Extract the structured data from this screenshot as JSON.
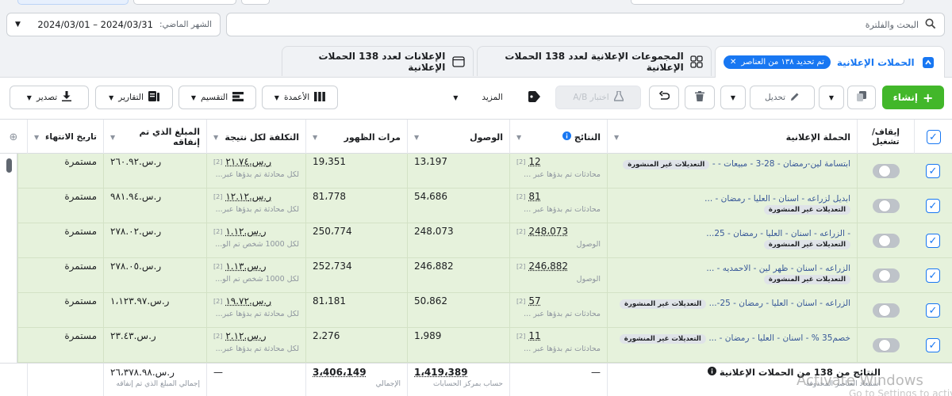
{
  "date_range": {
    "label": "الشهر الماضي:",
    "range": "2024/03/01 – 2024/03/31"
  },
  "search": {
    "placeholder": "البحث والفلترة"
  },
  "tabs": [
    {
      "label": "الحملات الإعلانية",
      "chip": "تم تحديد ١٣٨ من العناصر"
    },
    {
      "label": "المجموعات الإعلانية لعدد 138 الحملات الإعلانية"
    },
    {
      "label": "الإعلانات لعدد 138 الحملات الإعلانية"
    }
  ],
  "toolbar": {
    "create": "إنشاء",
    "edit": "تحديل",
    "ab_test": "اختبار A/B",
    "more": "المزيد",
    "columns": "الأعمدة",
    "breakdown": "التقسيم",
    "reports": "التقارير",
    "export": "تصدير"
  },
  "columns": {
    "toggle": "إيقاف/ تشغيل",
    "campaign": "الحملة الإعلانية",
    "results": "النتائج",
    "reach": "الوصول",
    "impressions": "مرات الظهور",
    "cost_per_result": "التكلفة لكل نتيجة",
    "amount_spent": "المبلغ الذي تم إنفاقه",
    "end_date": "تاريخ الانتهاء"
  },
  "badge_label": "التعديلات غير المنشورة",
  "rows": [
    {
      "name": "ابتسامة لين-رمضان - 28-3 - مبيعات - -",
      "results": "12",
      "results_sub": "محادثات تم بدؤها عبر ...",
      "reach": "13،197",
      "impressions": "19،351",
      "cpr": "ر.س.٢١.٧٤",
      "cpr_sub": "لكل محادثة تم بدؤها عبر...",
      "spent": "ر.س.٢٦٠.٩٢",
      "end": "مستمرة"
    },
    {
      "name": "ابديل لزراعه - اسنان - العليا - رمضان - ...",
      "results": "81",
      "results_sub": "محادثات تم بدؤها عبر ...",
      "reach": "54،686",
      "impressions": "81،778",
      "cpr": "ر.س.١٢.١٢",
      "cpr_sub": "لكل محادثة تم بدؤها عبر...",
      "spent": "ر.س.٩٨١.٩٤",
      "end": "مستمرة"
    },
    {
      "name": "- الزراعه - اسنان - العليا - رمضان - 25...",
      "results": "248،073",
      "results_sub": "الوصول",
      "reach": "248،073",
      "impressions": "250،774",
      "cpr": "ر.س.١.١٢",
      "cpr_sub": "لكل 1000 شخص تم الو...",
      "spent": "ر.س.٢٧٨.٠٢",
      "end": "مستمرة"
    },
    {
      "name": "الزراعه - اسنان - ظهر لين - الاحمديه - ...",
      "results": "246،882",
      "results_sub": "الوصول",
      "reach": "246،882",
      "impressions": "252،734",
      "cpr": "ر.س.١.١٣",
      "cpr_sub": "لكل 1000 شخص تم الو...",
      "spent": "ر.س.٢٧٨.٠٥",
      "end": "مستمرة"
    },
    {
      "name": "الزراعه - اسنان - العليا - رمضان - 25-...",
      "results": "57",
      "results_sub": "محادثات تم بدؤها عبر ...",
      "reach": "50،862",
      "impressions": "81،181",
      "cpr": "ر.س.١٩.٧٢",
      "cpr_sub": "لكل محادثة تم بدؤها عبر...",
      "spent": "ر.س.١،١٢٣.٩٧",
      "end": "مستمرة"
    },
    {
      "name": "خصم35 % - اسنان - العليا - رمضان - ...",
      "results": "11",
      "results_sub": "محادثات تم بدؤها عبر ...",
      "reach": "1،989",
      "impressions": "2،276",
      "cpr": "ر.س.٢.١٢",
      "cpr_sub": "لكل محادثة تم بدؤها عبر...",
      "spent": "ر.س.٢٣.٤٣",
      "end": "مستمرة"
    }
  ],
  "totals": {
    "label": "النتائج من 138 من الحملات الإعلانية",
    "label_sub": "استبعاد العناصر المحذوفة",
    "results": "—",
    "reach": "1،419،389",
    "reach_sub": "حساب بمركز الحسابات",
    "impressions": "3،406،149",
    "impressions_sub": "الإجمالي",
    "cpr": "—",
    "spent": "ر.س.٢٦،٣٧٨.٩٨",
    "spent_sub": "إجمالي المبلغ الذي تم إنفاقه"
  },
  "watermark": {
    "title": "Activate Windows",
    "sub": "Go to Settings to activate Windows."
  },
  "colors": {
    "accent": "#1877f2",
    "create": "#42b72a",
    "selected_row": "#e6f2dc"
  }
}
